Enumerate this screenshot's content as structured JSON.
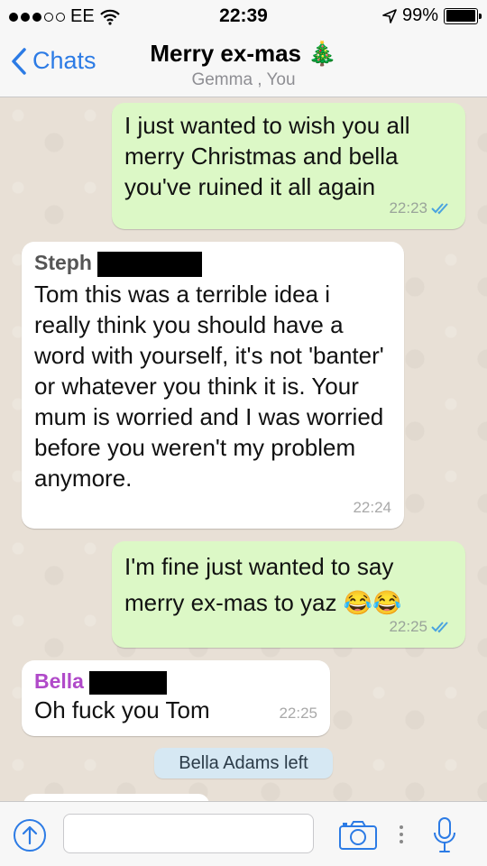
{
  "status_bar": {
    "carrier": "EE",
    "time": "22:39",
    "battery_percent": "99%",
    "battery_level": 0.99
  },
  "nav": {
    "back_label": "Chats",
    "title": "Merry ex-mas 🎄",
    "subtitle": "Gemma , You"
  },
  "messages": [
    {
      "direction": "outgoing",
      "text": "I just wanted to wish you all merry Christmas and bella you've ruined it all again",
      "time": "22:23",
      "read": true
    },
    {
      "direction": "incoming",
      "sender": "Steph",
      "sender_color": "#555555",
      "text": "Tom this was a terrible idea i really think you should have a word with yourself, it's not 'banter' or whatever you think it is. Your mum is worried and I was worried before you weren't my problem anymore.",
      "time": "22:24"
    },
    {
      "direction": "outgoing",
      "text": "I'm fine just wanted to say merry ex-mas to yaz 😂😂",
      "time": "22:25",
      "read": true
    },
    {
      "direction": "incoming",
      "sender": "Bella",
      "sender_color": "#b04ac9",
      "text": "Oh fuck you Tom",
      "time": "22:25"
    }
  ],
  "system_message": "Bella Adams left",
  "colors": {
    "accent": "#2c7be5",
    "outgoing_bubble": "#dcf8c6",
    "incoming_bubble": "#ffffff",
    "read_ticks": "#4aa3df"
  },
  "icons": {
    "upload": "upload-circle-icon",
    "camera": "camera-icon",
    "microphone": "microphone-icon"
  }
}
